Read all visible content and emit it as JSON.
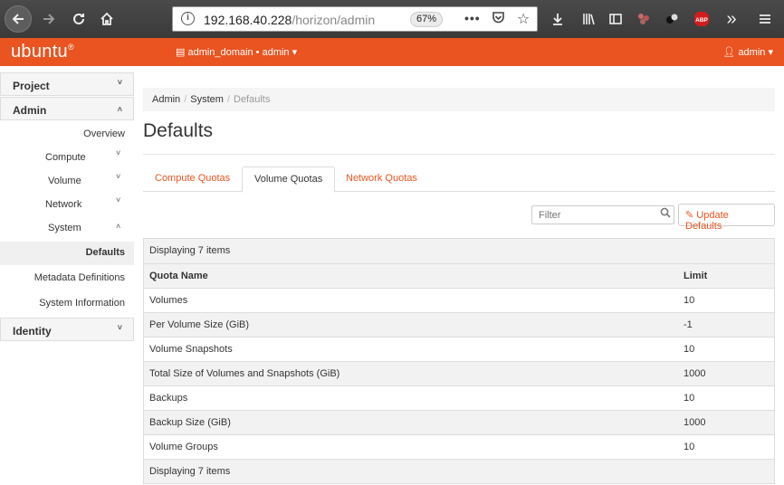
{
  "browser": {
    "url_host": "192.168.40.228",
    "url_path": "/horizon/admin",
    "zoom": "67%"
  },
  "navbar": {
    "logo": "ubuntu",
    "domain_project": "admin_domain • admin",
    "user": "admin"
  },
  "sidebar": {
    "project": "Project",
    "admin": "Admin",
    "overview": "Overview",
    "compute": "Compute",
    "volume": "Volume",
    "network": "Network",
    "system": "System",
    "defaults": "Defaults",
    "metadata": "Metadata Definitions",
    "system_info": "System Information",
    "identity": "Identity"
  },
  "breadcrumb": [
    "Admin",
    "System",
    "Defaults"
  ],
  "page_title": "Defaults",
  "tabs": [
    {
      "label": "Compute Quotas",
      "active": false
    },
    {
      "label": "Volume Quotas",
      "active": true
    },
    {
      "label": "Network Quotas",
      "active": false
    }
  ],
  "filter_placeholder": "Filter",
  "update_button": "Update Defaults",
  "table": {
    "count_text": "Displaying 7 items",
    "columns": [
      "Quota Name",
      "Limit"
    ],
    "rows": [
      [
        "Volumes",
        "10"
      ],
      [
        "Per Volume Size (GiB)",
        "-1"
      ],
      [
        "Volume Snapshots",
        "10"
      ],
      [
        "Total Size of Volumes and Snapshots (GiB)",
        "1000"
      ],
      [
        "Backups",
        "10"
      ],
      [
        "Backup Size (GiB)",
        "1000"
      ],
      [
        "Volume Groups",
        "10"
      ]
    ],
    "footer_text": "Displaying 7 items"
  },
  "colors": {
    "accent": "#e95420"
  }
}
